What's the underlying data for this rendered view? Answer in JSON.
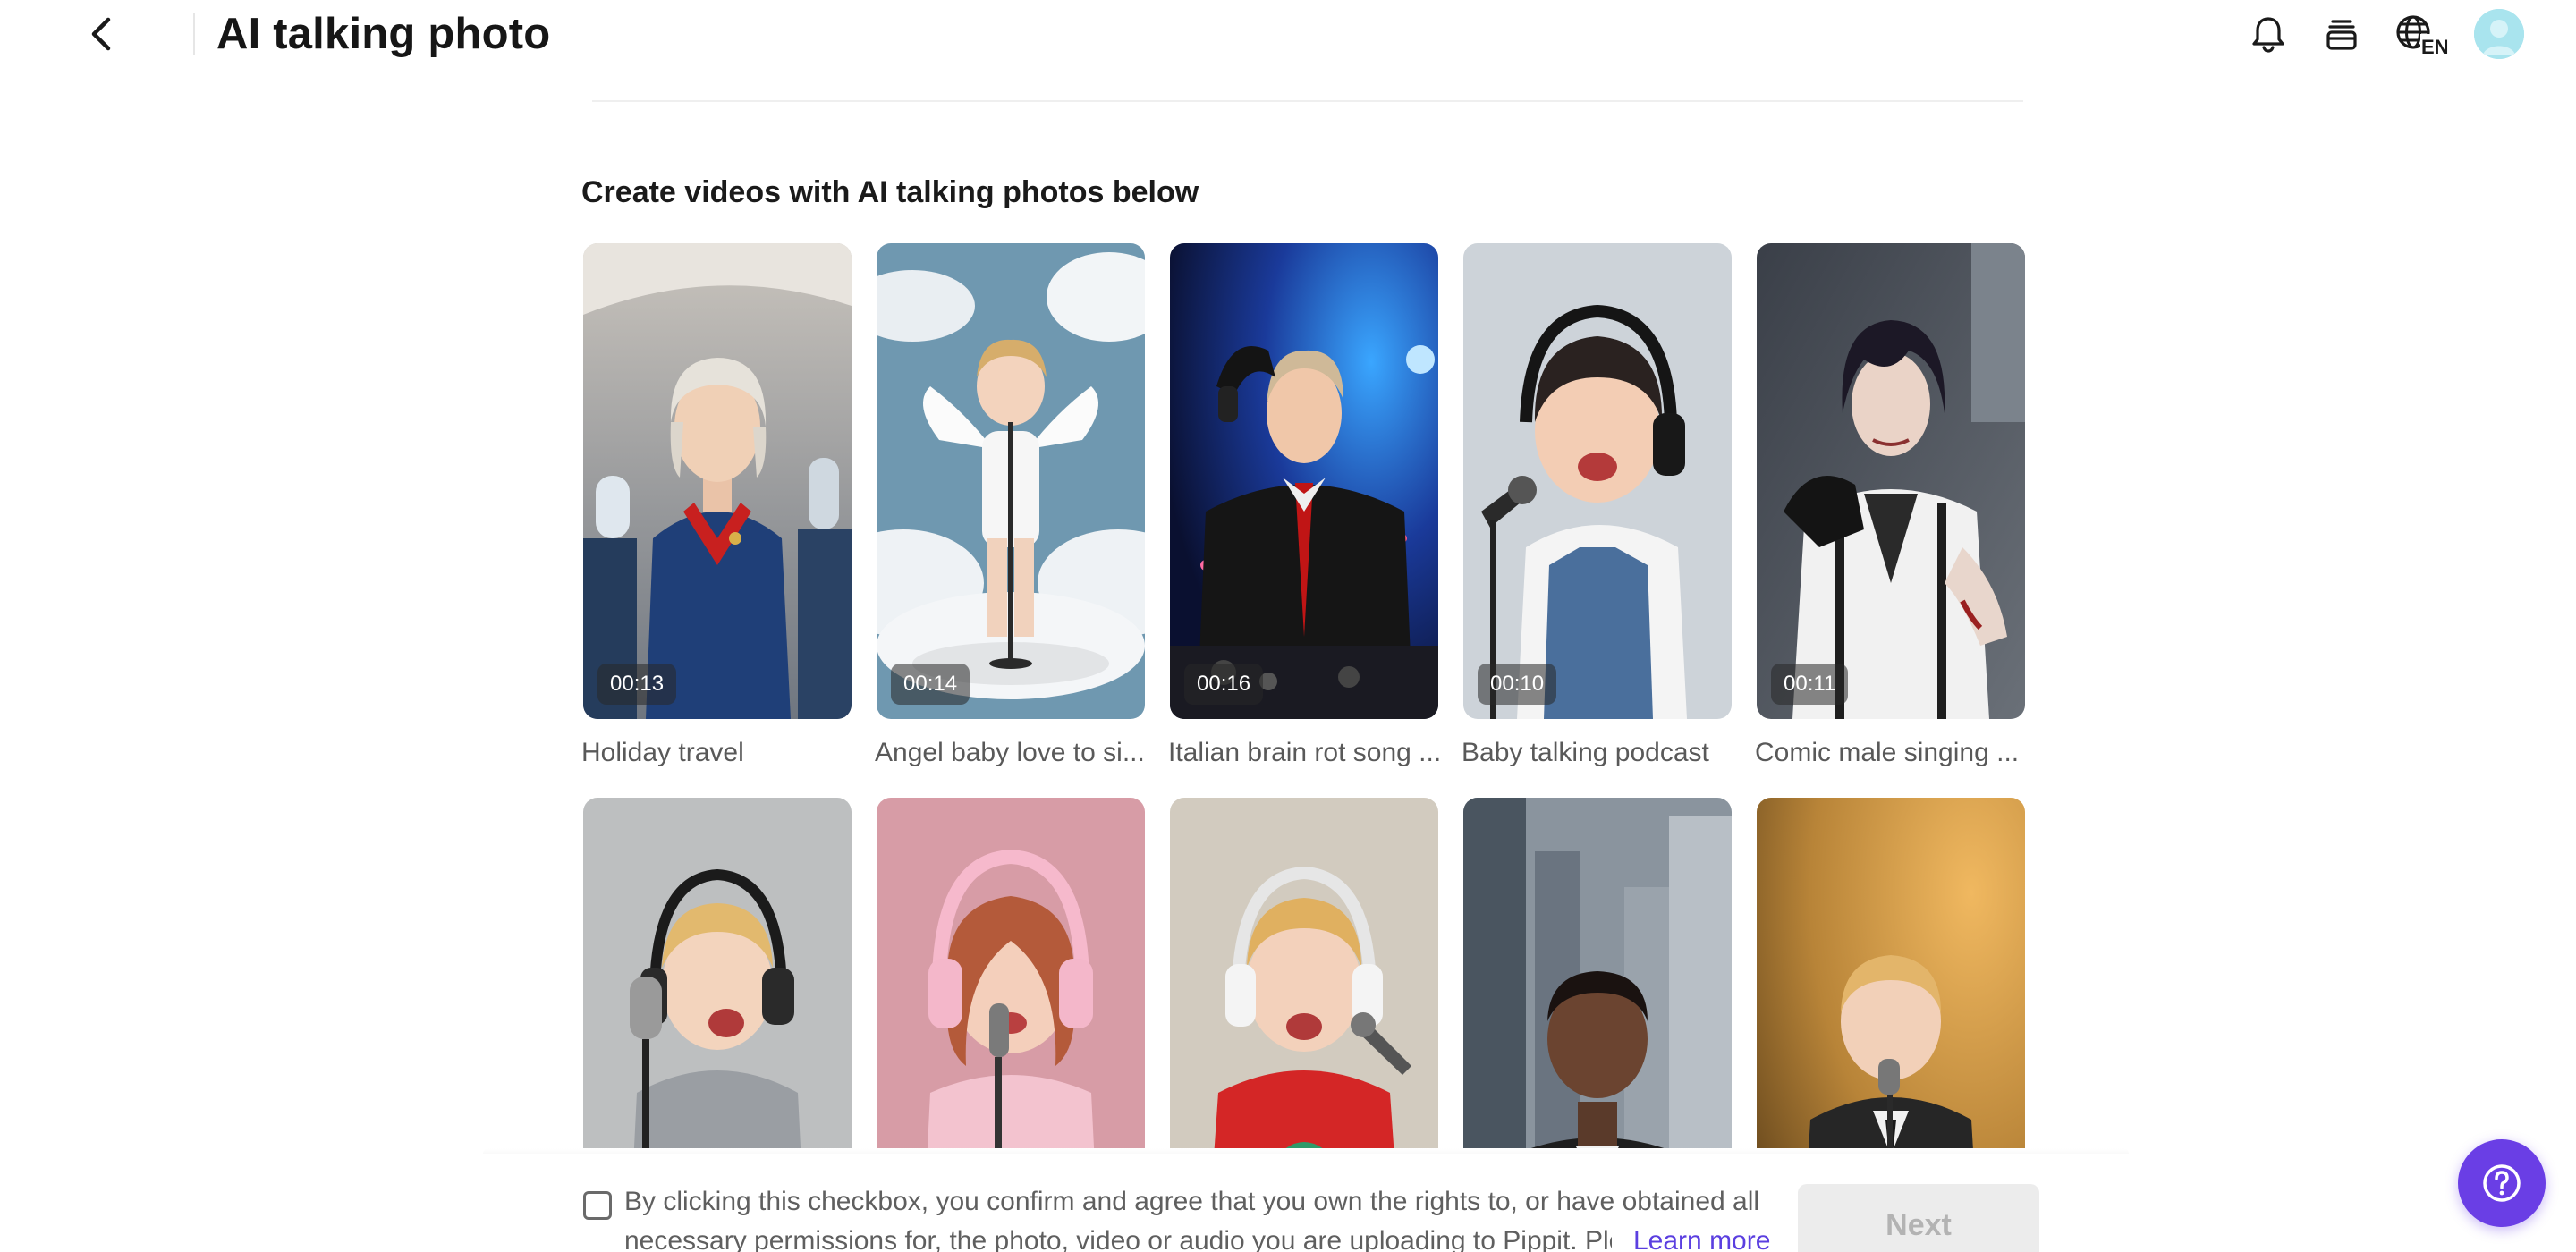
{
  "header": {
    "title": "AI talking photo",
    "language_code": "EN",
    "icons": {
      "back": "chevron-left-icon",
      "notifications": "bell-icon",
      "assets": "layers-icon",
      "language": "globe-icon",
      "avatar": "user-avatar"
    }
  },
  "section": {
    "title": "Create videos with AI talking photos below"
  },
  "cards": [
    {
      "label": "Holiday travel",
      "duration": "00:13"
    },
    {
      "label": "Angel baby love to si...",
      "duration": "00:14"
    },
    {
      "label": "Italian brain rot song ...",
      "duration": "00:16"
    },
    {
      "label": "Baby talking podcast",
      "duration": "00:10"
    },
    {
      "label": "Comic male singing ...",
      "duration": "00:11"
    },
    {
      "label": "",
      "duration": ""
    },
    {
      "label": "",
      "duration": ""
    },
    {
      "label": "",
      "duration": ""
    },
    {
      "label": "",
      "duration": ""
    },
    {
      "label": "",
      "duration": ""
    }
  ],
  "footer": {
    "consent_line1": "By clicking this checkbox, you confirm and agree that you own the rights to, or have obtained all",
    "consent_line2": "necessary permissions for, the photo, video or audio you are uploading to Pippit. Plea",
    "learn_more": "Learn more",
    "next_label": "Next",
    "checkbox_checked": false
  },
  "help": {
    "icon": "help-icon"
  },
  "colors": {
    "accent": "#6a3ee5",
    "link": "#5b3fe0",
    "avatar": "#a9e4ee",
    "disabled_button": "#ececec"
  }
}
